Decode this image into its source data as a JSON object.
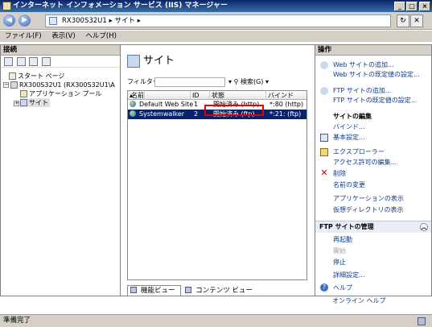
{
  "window": {
    "title": "インターネット インフォメーション サービス (IIS) マネージャー"
  },
  "address": {
    "path": "RX300S32U1 ▸ サイト ▸"
  },
  "menu": {
    "file": "ファイル(F)",
    "view": "表示(V)",
    "help": "ヘルプ(H)"
  },
  "connections": {
    "header": "接続",
    "tree": [
      {
        "label": "スタート ページ"
      },
      {
        "label": "RX300S32U1 (RX300S32U1\\A"
      },
      {
        "label": "アプリケーション プール"
      },
      {
        "label": "サイト"
      }
    ]
  },
  "center": {
    "title": "サイト",
    "filter_label": "フィルター:",
    "search_label": "検索(G)",
    "columns": {
      "name": "名前",
      "id": "ID",
      "status": "状態",
      "binding": "バインド"
    },
    "rows": [
      {
        "name": "Default Web Site",
        "id": "1",
        "status": "開始済み (http)",
        "binding": "*:80 (http)"
      },
      {
        "name": "Systemwalker",
        "id": "2",
        "status": "開始済み (ftp)",
        "binding": "*:21: (ftp)"
      }
    ],
    "tabs": {
      "features": "機能ビュー",
      "content": "コンテンツ ビュー"
    }
  },
  "actions": {
    "header": "操作",
    "add_web": "Web サイトの追加...",
    "web_defaults": "Web サイトの既定値の設定...",
    "add_ftp": "FTP サイトの追加...",
    "ftp_defaults": "FTP サイトの既定値の設定...",
    "edit_site": "サイトの編集",
    "bindings": "バインド...",
    "basic": "基本設定...",
    "explore": "エクスプローラー",
    "perms": "アクセス許可の編集...",
    "delete": "削除",
    "rename": "名前の変更",
    "view_apps": "アプリケーションの表示",
    "view_vdirs": "仮想ディレクトリの表示",
    "ftp_manage": "FTP サイトの管理",
    "restart": "再起動",
    "start": "開始",
    "stop": "停止",
    "advanced": "詳細設定...",
    "help": "ヘルプ",
    "online_help": "オンライン ヘルプ"
  },
  "status": {
    "text": "準備完了"
  }
}
